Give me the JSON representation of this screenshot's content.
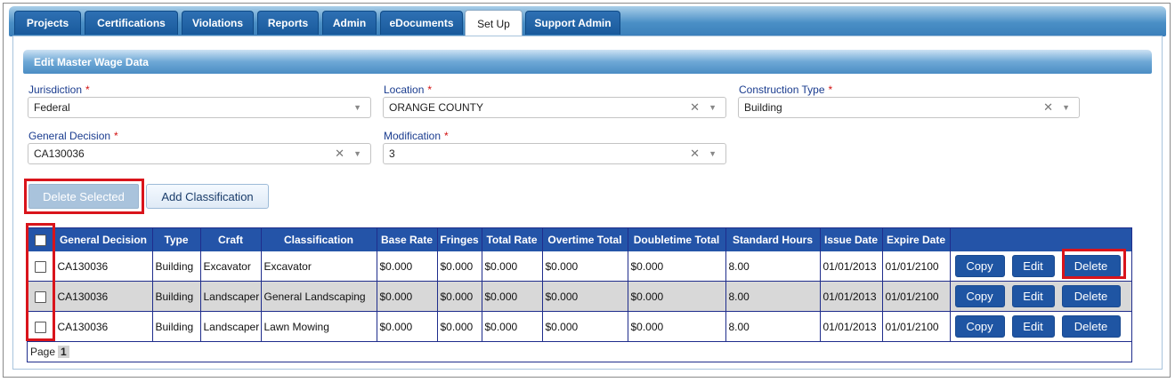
{
  "tabs": [
    {
      "label": "Projects",
      "active": false
    },
    {
      "label": "Certifications",
      "active": false
    },
    {
      "label": "Violations",
      "active": false
    },
    {
      "label": "Reports",
      "active": false
    },
    {
      "label": "Admin",
      "active": false
    },
    {
      "label": "eDocuments",
      "active": false
    },
    {
      "label": "Set Up",
      "active": true
    },
    {
      "label": "Support Admin",
      "active": false
    }
  ],
  "panel": {
    "title": "Edit Master Wage Data"
  },
  "form": {
    "required_mark": "*",
    "jurisdiction": {
      "label": "Jurisdiction",
      "value": "Federal"
    },
    "location": {
      "label": "Location",
      "value": "ORANGE COUNTY"
    },
    "construction_type": {
      "label": "Construction Type",
      "value": "Building"
    },
    "general_decision": {
      "label": "General Decision",
      "value": "CA130036"
    },
    "modification": {
      "label": "Modification",
      "value": "3"
    }
  },
  "buttons": {
    "delete_selected": "Delete Selected",
    "add_classification": "Add Classification"
  },
  "grid": {
    "columns": [
      "General Decision",
      "Type",
      "Craft",
      "Classification",
      "Base Rate",
      "Fringes",
      "Total Rate",
      "Overtime Total",
      "Doubletime Total",
      "Standard Hours",
      "Issue Date",
      "Expire Date"
    ],
    "rows": [
      {
        "general_decision": "CA130036",
        "type": "Building",
        "craft": "Excavator",
        "classification": "Excavator",
        "base_rate": "$0.000",
        "fringes": "$0.000",
        "total_rate": "$0.000",
        "overtime_total": "$0.000",
        "doubletime_total": "$0.000",
        "standard_hours": "8.00",
        "issue_date": "01/01/2013",
        "expire_date": "01/01/2100"
      },
      {
        "general_decision": "CA130036",
        "type": "Building",
        "craft": "Landscaper",
        "classification": "General Landscaping",
        "base_rate": "$0.000",
        "fringes": "$0.000",
        "total_rate": "$0.000",
        "overtime_total": "$0.000",
        "doubletime_total": "$0.000",
        "standard_hours": "8.00",
        "issue_date": "01/01/2013",
        "expire_date": "01/01/2100"
      },
      {
        "general_decision": "CA130036",
        "type": "Building",
        "craft": "Landscaper",
        "classification": "Lawn Mowing",
        "base_rate": "$0.000",
        "fringes": "$0.000",
        "total_rate": "$0.000",
        "overtime_total": "$0.000",
        "doubletime_total": "$0.000",
        "standard_hours": "8.00",
        "issue_date": "01/01/2013",
        "expire_date": "01/01/2100"
      }
    ],
    "row_actions": {
      "copy": "Copy",
      "edit": "Edit",
      "delete": "Delete"
    },
    "pager": {
      "label": "Page",
      "current": "1"
    }
  },
  "colors": {
    "tab_bg": "#195a9c",
    "header_bg": "#2454a8",
    "action_button": "#1f55a3",
    "highlight": "#d9141b",
    "label_text": "#1a3c8f"
  }
}
